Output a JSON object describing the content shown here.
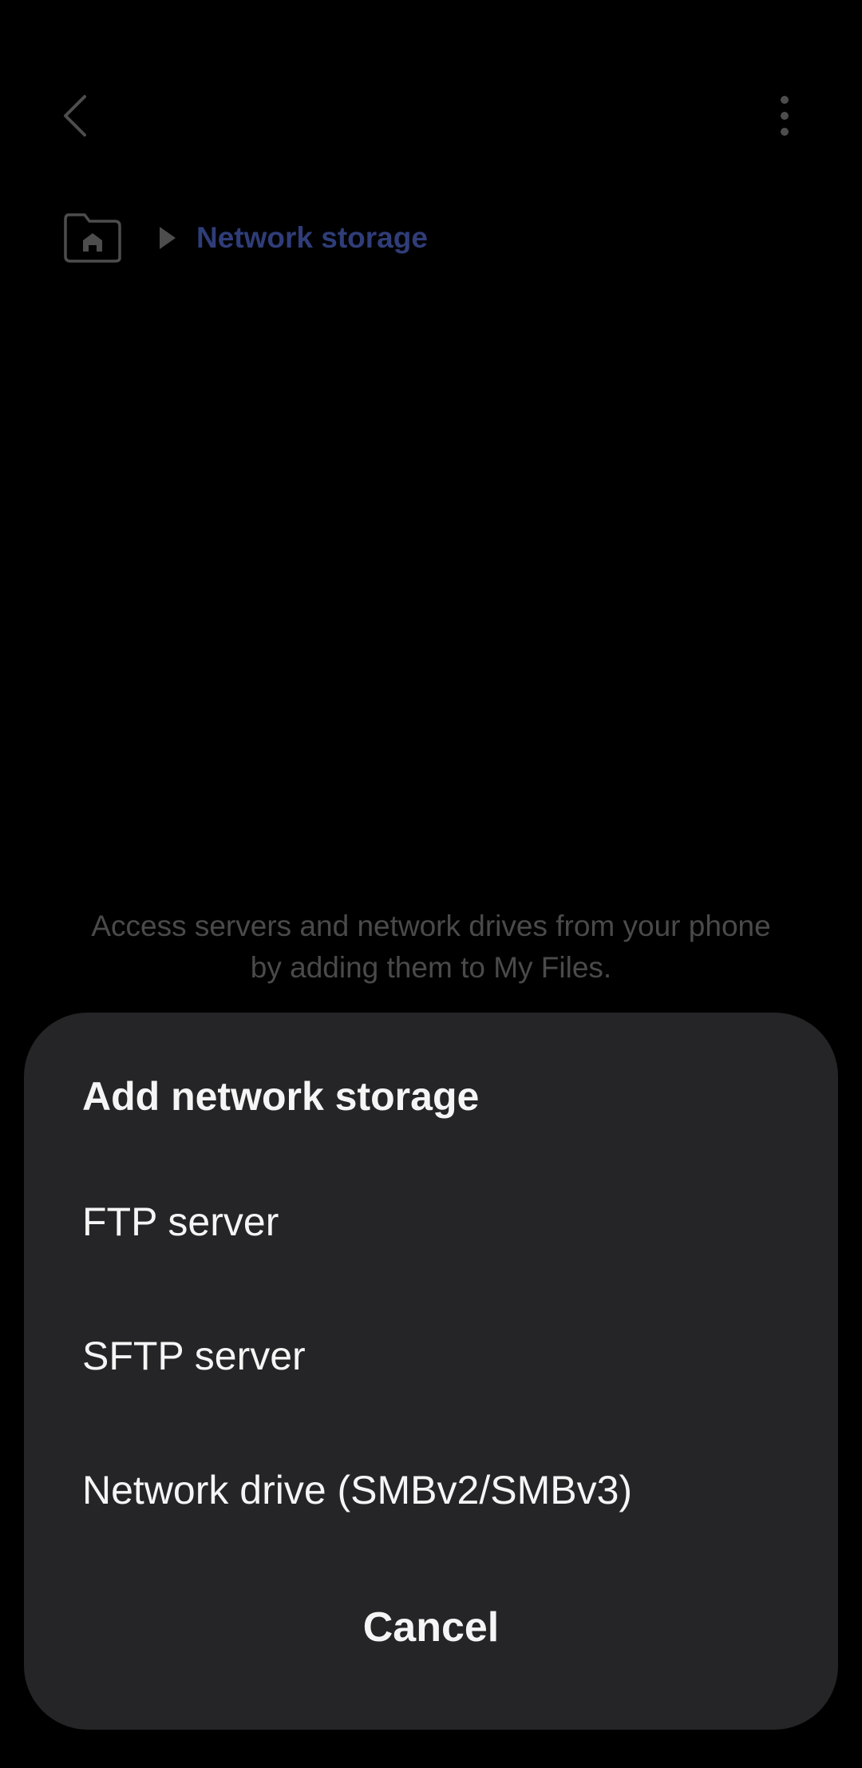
{
  "app_bar": {
    "back_icon": "chevron-left-icon",
    "more_icon": "more-vertical-icon"
  },
  "breadcrumb": {
    "home_icon": "home-folder-icon",
    "separator_icon": "play-triangle-icon",
    "current": "Network storage"
  },
  "empty_state": {
    "description": "Access servers and network drives from your phone by adding them to My Files."
  },
  "sheet": {
    "title": "Add network storage",
    "options": [
      {
        "label": "FTP server"
      },
      {
        "label": "SFTP server"
      },
      {
        "label": "Network drive (SMBv2/SMBv3)"
      }
    ],
    "cancel_label": "Cancel"
  },
  "colors": {
    "background": "#000000",
    "sheet": "#252527",
    "breadcrumb_accent": "#2f3d78",
    "dimmed_text": "#4a4a4a",
    "text": "#f5f5f5"
  }
}
